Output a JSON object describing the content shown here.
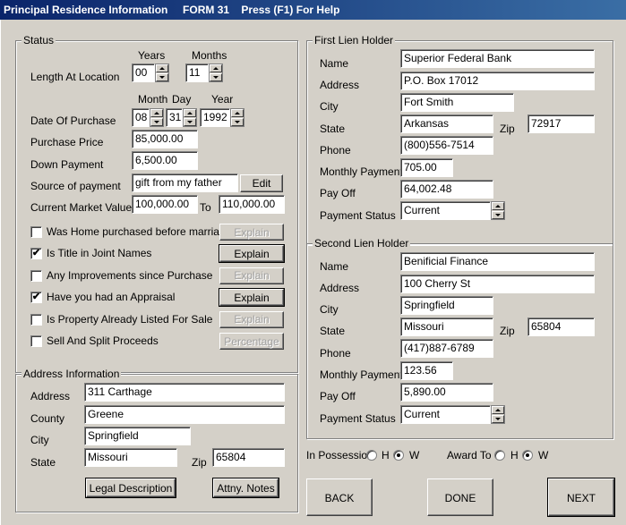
{
  "title": {
    "name": "Principal Residence Information",
    "form": "FORM 31",
    "help": "Press (F1) For Help"
  },
  "status": {
    "group_label": "Status",
    "years_label": "Years",
    "months_label": "Months",
    "length_label": "Length At Location",
    "years_value": "00",
    "months_value": "11",
    "month_label": "Month",
    "day_label": "Day",
    "year_label": "Year",
    "purchase_label": "Date Of Purchase",
    "purchase_month": "08",
    "purchase_day": "31",
    "purchase_year": "1992",
    "price_label": "Purchase Price",
    "price_value": "85,000.00",
    "down_label": "Down Payment",
    "down_value": "6,500.00",
    "source_label": "Source of payment",
    "source_value": "gift from my father",
    "edit_button": "Edit",
    "market_label": "Current Market Value",
    "market_from": "100,000.00",
    "to_label": "To",
    "market_to": "110,000.00",
    "checks": [
      {
        "label": "Was Home purchased before marriage",
        "checked": false,
        "button": "Explain",
        "enabled": false
      },
      {
        "label": "Is Title in Joint Names",
        "checked": true,
        "button": "Explain",
        "enabled": true
      },
      {
        "label": "Any Improvements since Purchase",
        "checked": false,
        "button": "Explain",
        "enabled": false
      },
      {
        "label": "Have you had an Appraisal",
        "checked": true,
        "button": "Explain",
        "enabled": true
      },
      {
        "label": "Is Property Already Listed For Sale",
        "checked": false,
        "button": "Explain",
        "enabled": false
      },
      {
        "label": "Sell And Split Proceeds",
        "checked": false,
        "button": "Percentage",
        "enabled": false
      }
    ],
    "check_mark": "✔"
  },
  "address": {
    "group_label": "Address Information",
    "address_label": "Address",
    "address_value": "311 Carthage",
    "county_label": "County",
    "county_value": "Greene",
    "city_label": "City",
    "city_value": "Springfield",
    "state_label": "State",
    "state_value": "Missouri",
    "zip_label": "Zip",
    "zip_value": "65804",
    "legal_button": "Legal Description",
    "notes_button": "Attny. Notes"
  },
  "first_lien": {
    "group_label": "First Lien Holder",
    "name_label": "Name",
    "name_value": "Superior Federal Bank",
    "address_label": "Address",
    "address_value": "P.O. Box 17012",
    "city_label": "City",
    "city_value": "Fort Smith",
    "state_label": "State",
    "state_value": "Arkansas",
    "zip_label": "Zip",
    "zip_value": "72917",
    "phone_label": "Phone",
    "phone_value": "(800)556-7514",
    "monthly_label": "Monthly Payment",
    "monthly_value": "705.00",
    "payoff_label": "Pay Off",
    "payoff_value": "64,002.48",
    "status_label": "Payment Status",
    "status_value": "Current"
  },
  "second_lien": {
    "group_label": "Second Lien Holder",
    "name_label": "Name",
    "name_value": "Benificial Finance",
    "address_label": "Address",
    "address_value": "100 Cherry St",
    "city_label": "City",
    "city_value": "Springfield",
    "state_label": "State",
    "state_value": "Missouri",
    "zip_label": "Zip",
    "zip_value": "65804",
    "phone_label": "Phone",
    "phone_value": "(417)887-6789",
    "monthly_label": "Monthly Payment",
    "monthly_value": "123.56",
    "payoff_label": "Pay Off",
    "payoff_value": "5,890.00",
    "status_label": "Payment Status",
    "status_value": "Current"
  },
  "possession": {
    "label": "In Possession",
    "h_label": "H",
    "w_label": "W",
    "selected": "W"
  },
  "award": {
    "label": "Award To",
    "h_label": "H",
    "w_label": "W",
    "selected": "W"
  },
  "nav": {
    "back": "BACK",
    "done": "DONE",
    "next": "NEXT"
  }
}
